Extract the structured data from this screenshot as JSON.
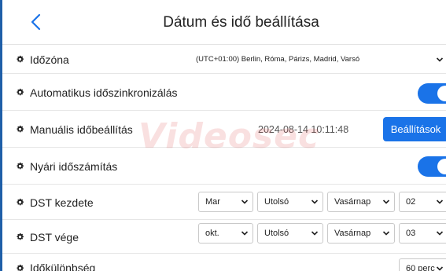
{
  "header": {
    "title": "Dátum és idő beállítása",
    "back_icon": "chevron-left-icon"
  },
  "rows": {
    "timezone": {
      "label": "Időzóna",
      "value": "(UTC+01:00) Berlin, Róma, Párizs, Madrid, Varsó"
    },
    "auto_sync": {
      "label": "Automatikus időszinkronizálás",
      "enabled": true
    },
    "manual": {
      "label": "Manuális időbeállítás",
      "datetime": "2024-08-14  10:11:48",
      "button": "Beállítások"
    },
    "dst": {
      "label": "Nyári időszámítás",
      "enabled": true
    },
    "dst_start": {
      "label": "DST kezdete",
      "month": "Mar",
      "week": "Utolsó",
      "day": "Vasárnap",
      "hour": "02"
    },
    "dst_end": {
      "label": "DST vége",
      "month": "okt.",
      "week": "Utolsó",
      "day": "Vasárnap",
      "hour": "03"
    },
    "offset": {
      "label": "Időkülönbség",
      "value": "60 perc"
    }
  },
  "watermark": "Videosec",
  "colors": {
    "accent": "#1a73e8",
    "border_left": "#1f5fa8",
    "watermark": "#d73c3c"
  }
}
